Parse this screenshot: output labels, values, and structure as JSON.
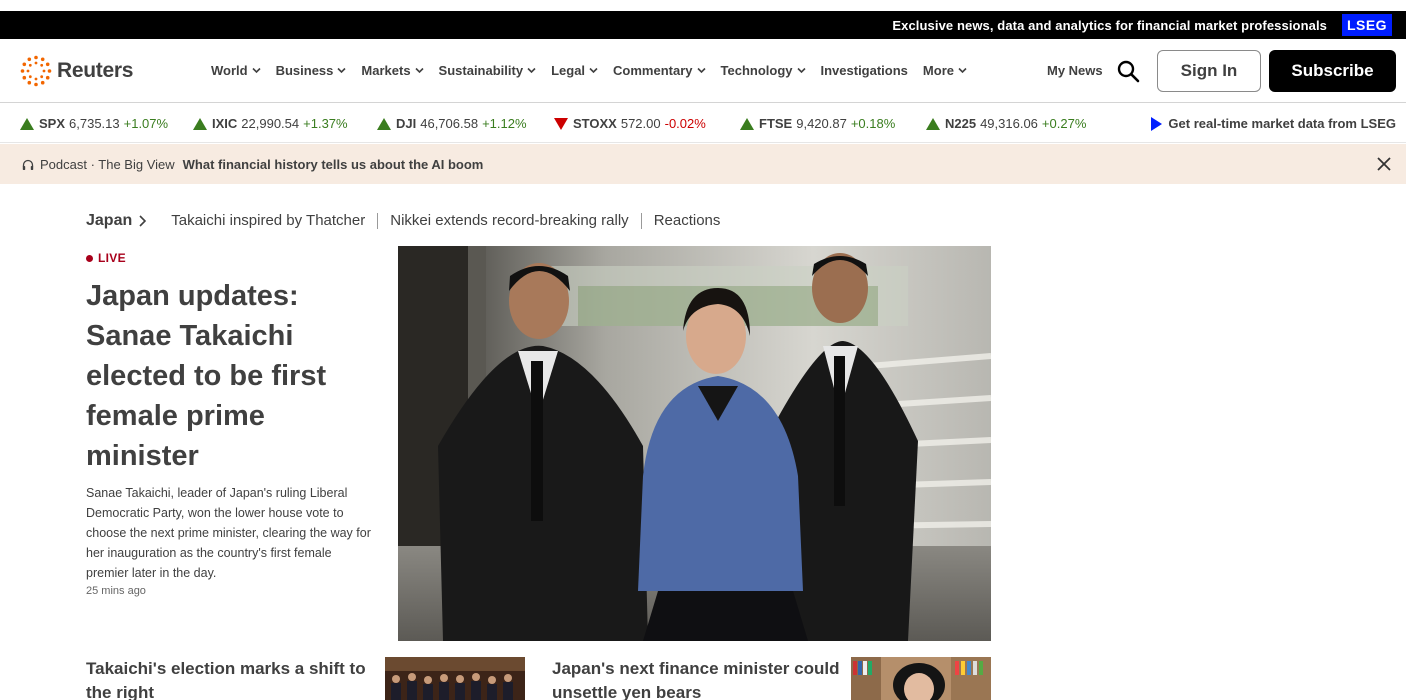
{
  "promo": {
    "text": "Exclusive news, data and analytics for financial market professionals",
    "badge": "LSEG"
  },
  "header": {
    "logo_text": "Reuters",
    "nav": [
      "World",
      "Business",
      "Markets",
      "Sustainability",
      "Legal",
      "Commentary",
      "Technology",
      "Investigations",
      "More"
    ],
    "nav_has_dropdown": [
      true,
      true,
      true,
      true,
      true,
      true,
      true,
      false,
      true
    ],
    "my_news": "My News",
    "sign_in": "Sign In",
    "subscribe": "Subscribe"
  },
  "ticker": [
    {
      "symbol": "SPX",
      "value": "6,735.13",
      "change": "+1.07%",
      "direction": "up"
    },
    {
      "symbol": "IXIC",
      "value": "22,990.54",
      "change": "+1.37%",
      "direction": "up"
    },
    {
      "symbol": "DJI",
      "value": "46,706.58",
      "change": "+1.12%",
      "direction": "up"
    },
    {
      "symbol": "STOXX",
      "value": "572.00",
      "change": "-0.02%",
      "direction": "down"
    },
    {
      "symbol": "FTSE",
      "value": "9,420.87",
      "change": "+0.18%",
      "direction": "up"
    },
    {
      "symbol": "N225",
      "value": "49,316.06",
      "change": "+0.27%",
      "direction": "up"
    }
  ],
  "lseg_link": "Get real-time market data from LSEG",
  "podcast": {
    "label": "Podcast · The Big View",
    "title": "What financial history tells us about the AI boom"
  },
  "topic": {
    "main": "Japan",
    "links": [
      "Takaichi inspired by Thatcher",
      "Nikkei extends record-breaking rally",
      "Reactions"
    ]
  },
  "lead_story": {
    "live_label": "LIVE",
    "headline": "Japan updates: Sanae Takaichi elected to be first female prime minister",
    "summary": "Sanae Takaichi, leader of Japan's ruling Liberal Democratic Party, won the lower house vote to choose the next prime minister, clearing the way for her inauguration as the country's first female premier later in the day.",
    "time": "25 mins ago"
  },
  "stories": [
    {
      "title": "Takaichi's election marks a shift to the right"
    },
    {
      "title": "Japan's next finance minister could unsettle yen bears"
    }
  ],
  "colors": {
    "up": "#3a7d1f",
    "down": "#cc0000",
    "live": "#a8001b",
    "lseg_blue": "#001eff",
    "podcast_bg": "#f7ebe1"
  }
}
